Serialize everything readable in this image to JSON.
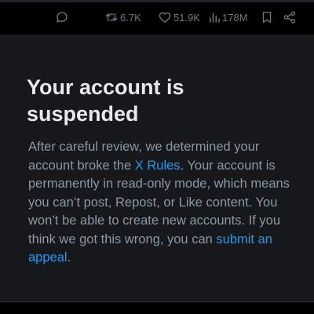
{
  "tweet_actions": {
    "reply": {
      "icon": "reply-icon"
    },
    "repost": {
      "icon": "repost-icon",
      "count": "6.7K"
    },
    "like": {
      "icon": "heart-icon",
      "count": "51.9K"
    },
    "views": {
      "icon": "views-chart-icon",
      "count": "178M"
    },
    "bookmark": {
      "icon": "bookmark-icon"
    },
    "share": {
      "icon": "share-icon"
    }
  },
  "suspension_notice": {
    "title": "Your account is suspended",
    "body_part1": "After careful review, we determined your account broke the ",
    "rules_link": "X Rules",
    "body_part2": ". Your account is permanently in read-only mode, which means you can’t post, Repost, or Like content. You won’t be able to create new accounts. If you think we got this wrong, you can ",
    "appeal_link": "submit an appeal",
    "body_end": "."
  },
  "colors": {
    "background": "#000000",
    "panel": "#16181c",
    "title_text": "#e7e9ea",
    "body_text": "#8b98a5",
    "link": "#1d9bf0",
    "icon": "#71767b"
  }
}
